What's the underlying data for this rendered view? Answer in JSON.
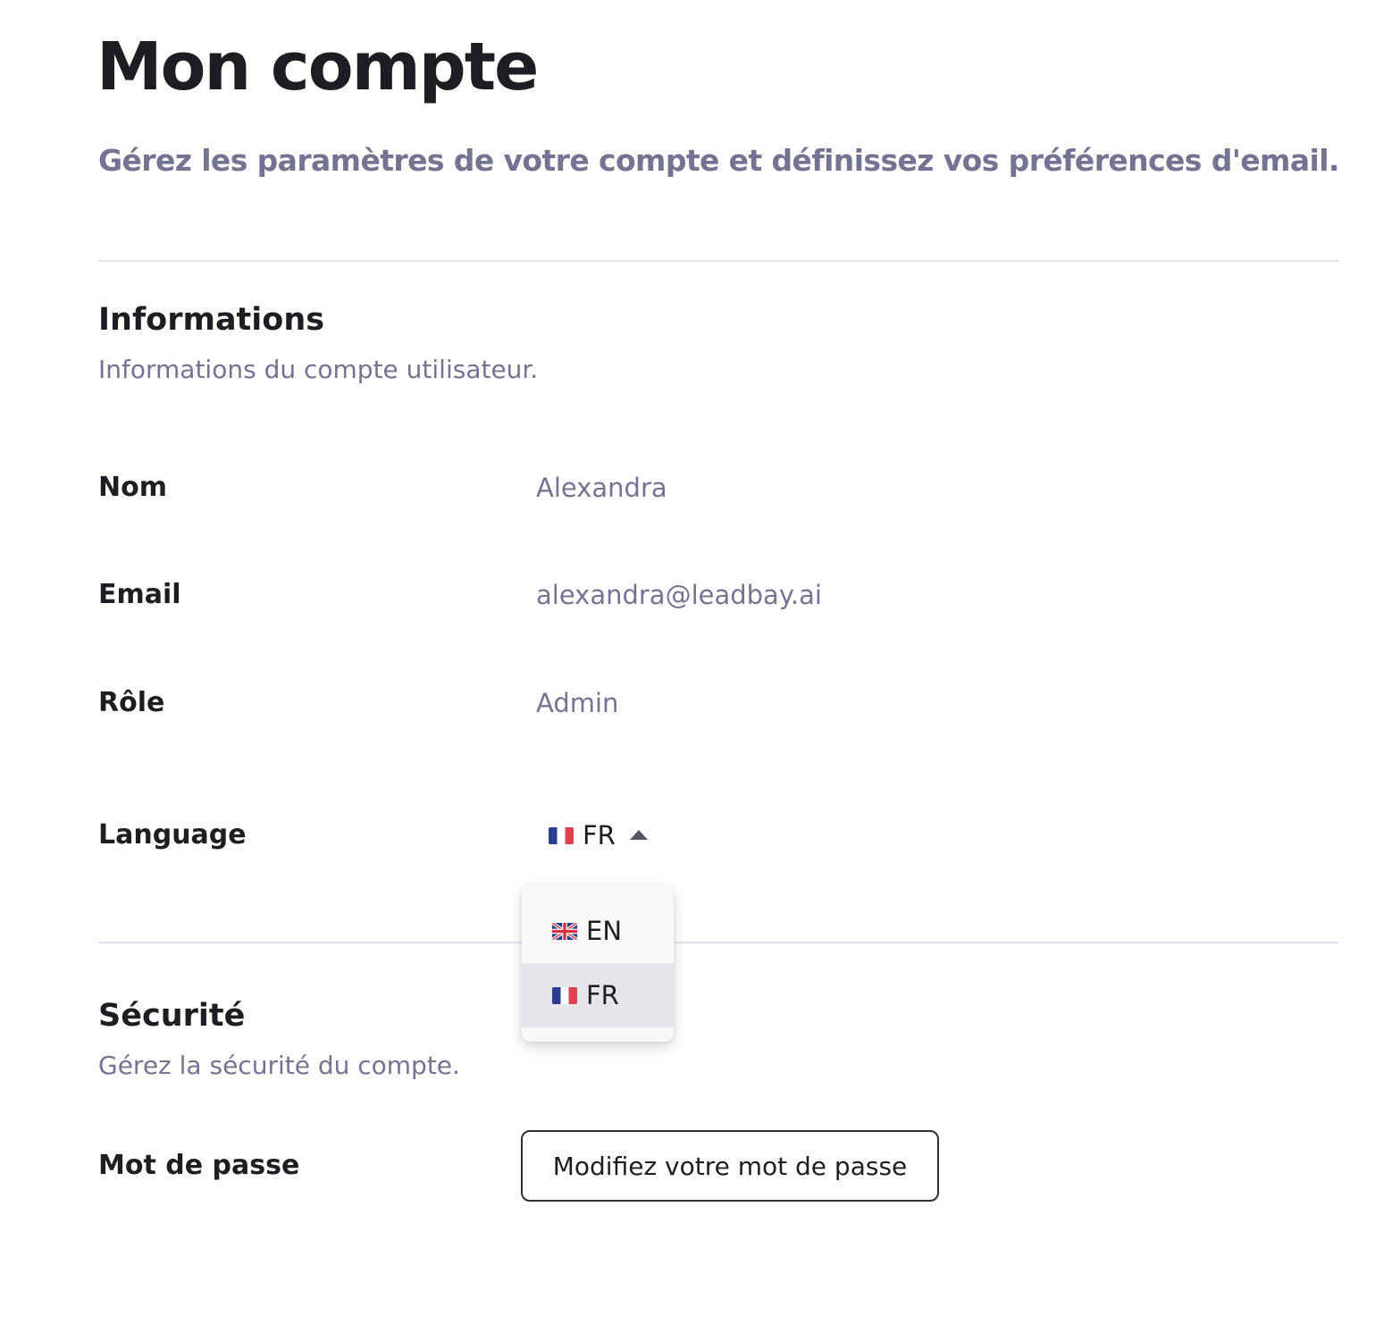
{
  "page": {
    "title": "Mon compte",
    "subtitle": "Gérez les paramètres de votre compte et définissez vos préférences d'email."
  },
  "informations": {
    "title": "Informations",
    "description": "Informations du compte utilisateur.",
    "fields": [
      {
        "label": "Nom",
        "value": "Alexandra"
      },
      {
        "label": "Email",
        "value": "alexandra@leadbay.ai"
      },
      {
        "label": "Rôle",
        "value": "Admin"
      }
    ],
    "language": {
      "label": "Language",
      "selected": "FR",
      "selected_flag": "france-flag-icon",
      "dropdown_open": true,
      "options": [
        {
          "code": "EN",
          "flag": "uk-flag-icon",
          "selected": false
        },
        {
          "code": "FR",
          "flag": "france-flag-icon",
          "selected": true
        }
      ]
    }
  },
  "securite": {
    "title": "Sécurité",
    "description": "Gérez la sécurité du compte.",
    "password": {
      "label": "Mot de passe",
      "button_label": "Modifiez votre mot de passe"
    }
  },
  "colors": {
    "text_primary": "#1e1e22",
    "text_muted": "#747492",
    "divider": "#e4e4e8",
    "dropdown_selected_bg": "#e5e5ea"
  }
}
